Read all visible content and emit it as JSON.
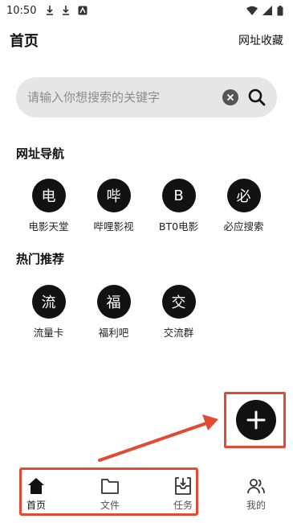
{
  "status_bar": {
    "time": "10:50"
  },
  "header": {
    "title": "首页",
    "favorites_label": "网址收藏"
  },
  "search": {
    "placeholder": "请输入你想搜索的关键字"
  },
  "sections": {
    "nav": {
      "title": "网址导航",
      "items": [
        {
          "glyph": "电",
          "label": "电影天堂"
        },
        {
          "glyph": "哔",
          "label": "哔哩影视"
        },
        {
          "glyph": "B",
          "label": "BT0电影"
        },
        {
          "glyph": "必",
          "label": "必应搜索"
        }
      ]
    },
    "hot": {
      "title": "热门推荐",
      "items": [
        {
          "glyph": "流",
          "label": "流量卡"
        },
        {
          "glyph": "福",
          "label": "福利吧"
        },
        {
          "glyph": "交",
          "label": "交流群"
        }
      ]
    }
  },
  "tabs": [
    {
      "label": "首页",
      "icon": "home-icon",
      "active": true
    },
    {
      "label": "文件",
      "icon": "folder-icon",
      "active": false
    },
    {
      "label": "任务",
      "icon": "download-task-icon",
      "active": false
    },
    {
      "label": "我的",
      "icon": "users-icon",
      "active": false
    }
  ],
  "colors": {
    "accent_annotation": "#e34a33",
    "tile_bg": "#121212",
    "search_bg": "#e6e6e6"
  }
}
